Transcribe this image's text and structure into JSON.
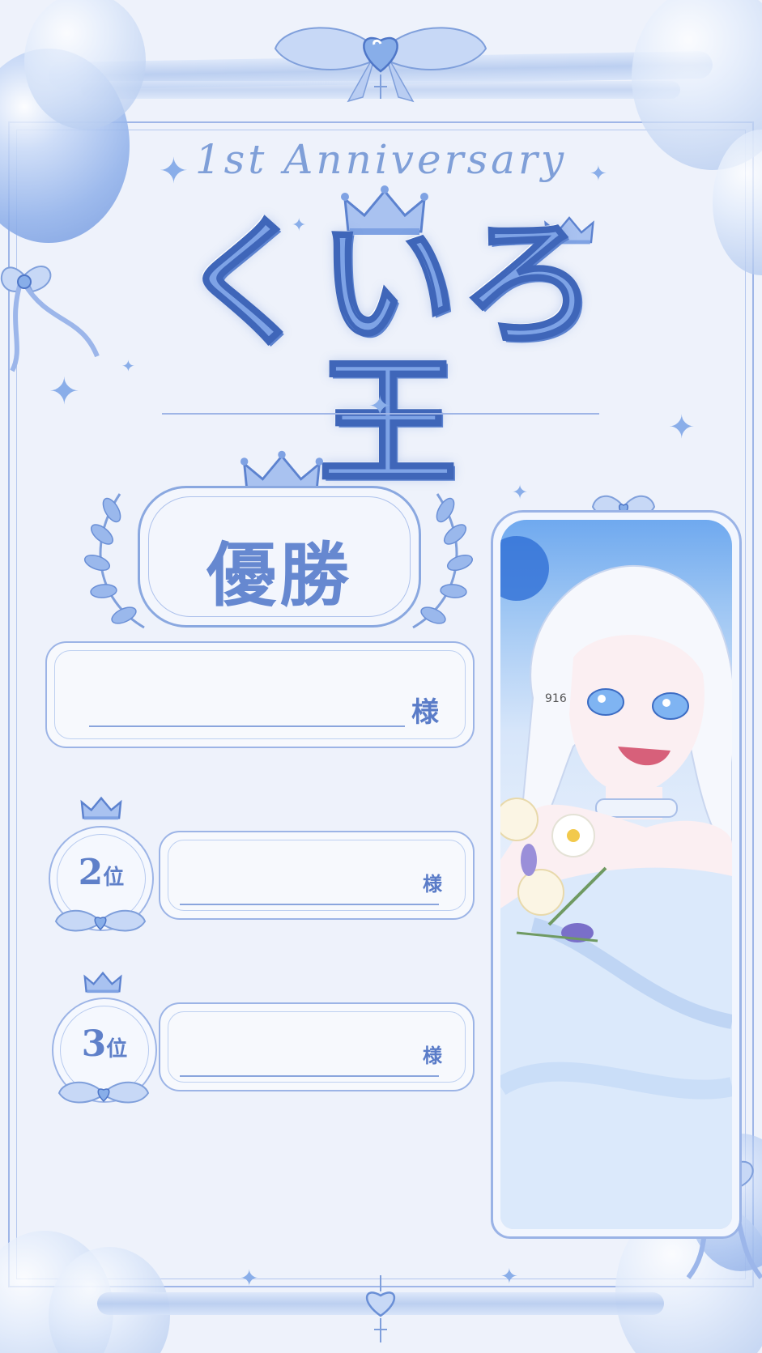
{
  "header": {
    "subtitle": "1st Anniversary",
    "title": "くいろ王"
  },
  "winner": {
    "label": "優勝",
    "honorific": "様"
  },
  "rankings": [
    {
      "number": "2",
      "suffix": "位",
      "honorific": "様"
    },
    {
      "number": "3",
      "suffix": "位",
      "honorific": "様"
    }
  ],
  "artwork": {
    "signature": "916"
  },
  "colors": {
    "background": "#eef2fb",
    "accent": "#7ea3e6",
    "line": "#9cb4e6",
    "text": "#5a7cc8"
  },
  "icons": [
    "crown-icon",
    "laurel-icon",
    "bow-icon",
    "sparkle-icon",
    "balloon-icon",
    "heart-jewel-icon"
  ]
}
